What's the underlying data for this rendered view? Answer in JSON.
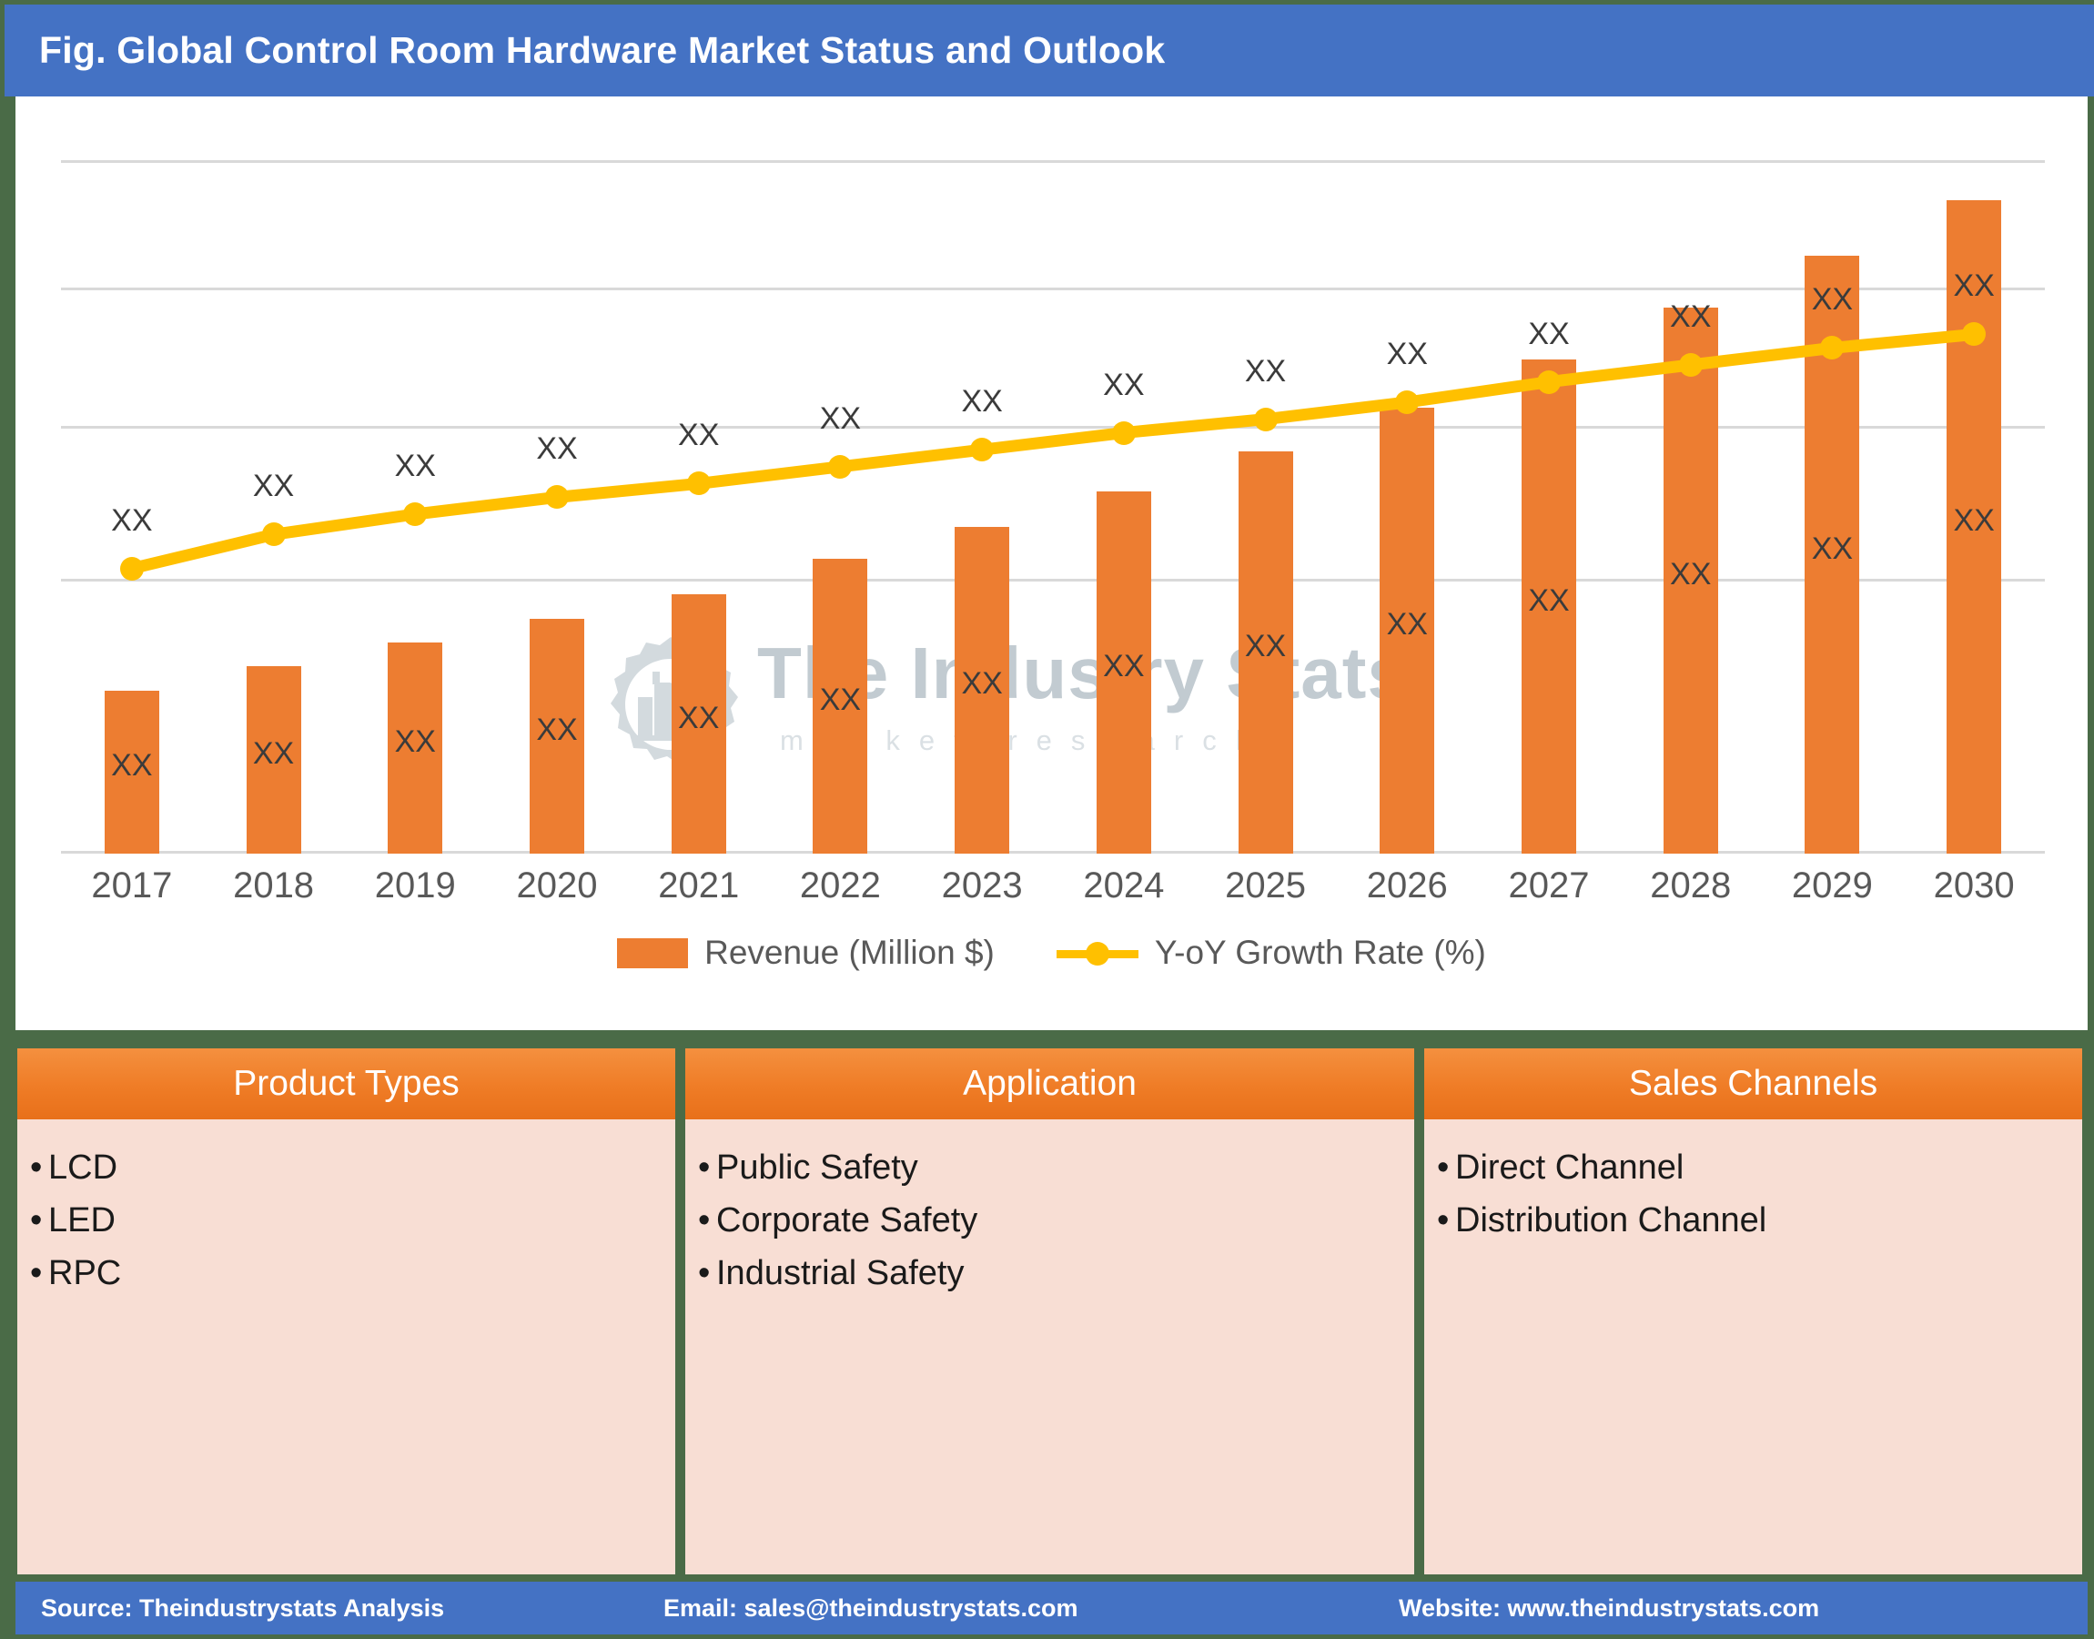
{
  "header": {
    "title": "Fig. Global Control Room Hardware Market Status and Outlook"
  },
  "watermark": {
    "brand": "The Industry Stats",
    "tagline": "m a r k e t   r e s e a r c h"
  },
  "chart_data": {
    "type": "bar",
    "title": "Fig. Global Control Room Hardware Market Status and Outlook",
    "xlabel": "",
    "ylabel": "",
    "grid": true,
    "legend_position": "bottom",
    "categories": [
      "2017",
      "2018",
      "2019",
      "2020",
      "2021",
      "2022",
      "2023",
      "2024",
      "2025",
      "2026",
      "2027",
      "2028",
      "2029",
      "2030"
    ],
    "series": [
      {
        "name": "Revenue (Million $)",
        "type": "bar",
        "color": "#ed7d31",
        "axis": "left",
        "values": [
          41,
          47,
          53,
          59,
          65,
          74,
          82,
          91,
          101,
          112,
          124,
          137,
          150,
          164
        ],
        "data_labels": [
          "XX",
          "XX",
          "XX",
          "XX",
          "XX",
          "XX",
          "XX",
          "XX",
          "XX",
          "XX",
          "XX",
          "XX",
          "XX",
          "XX"
        ]
      },
      {
        "name": "Y-oY Growth Rate (%)",
        "type": "line",
        "color": "#ffc000",
        "axis": "right",
        "values": [
          57,
          67,
          73,
          78,
          82,
          87,
          92,
          97,
          101,
          106,
          112,
          117,
          122,
          126
        ],
        "data_labels": [
          "XX",
          "XX",
          "XX",
          "XX",
          "XX",
          "XX",
          "XX",
          "XX",
          "XX",
          "XX",
          "XX",
          "XX",
          "XX",
          "XX"
        ]
      }
    ],
    "ylim": [
      0,
      200
    ],
    "gridline_values": [
      180,
      145,
      107,
      65
    ]
  },
  "legend": {
    "items": [
      {
        "label": "Revenue (Million $)",
        "marker": "bar-swatch",
        "color": "#ed7d31"
      },
      {
        "label": "Y-oY Growth Rate (%)",
        "marker": "line-dot-swatch",
        "color": "#ffc000"
      }
    ]
  },
  "cards": [
    {
      "title": "Product Types",
      "items": [
        "LCD",
        "LED",
        "RPC"
      ]
    },
    {
      "title": "Application",
      "items": [
        "Public Safety",
        "Corporate Safety",
        "Industrial Safety"
      ]
    },
    {
      "title": "Sales Channels",
      "items": [
        "Direct Channel",
        "Distribution Channel"
      ]
    }
  ],
  "footer": {
    "source": "Source: Theindustrystats Analysis",
    "email": "Email: sales@theindustrystats.com",
    "website": "Website: www.theindustrystats.com"
  },
  "colors": {
    "header_blue": "#4472c4",
    "panel_green": "#4a6b47",
    "bar_orange": "#ed7d31",
    "line_yellow": "#ffc000",
    "card_head_orange": "#ef7c26",
    "card_body_pink": "#f8ded4"
  }
}
